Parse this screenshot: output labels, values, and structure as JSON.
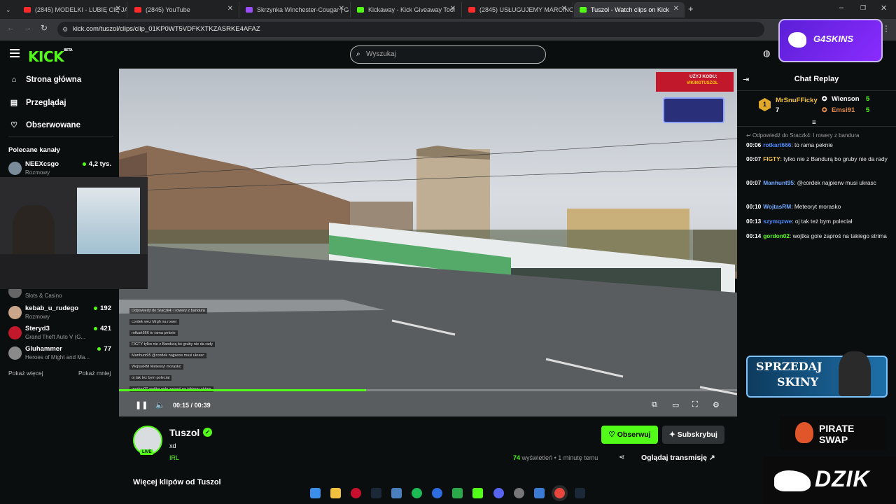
{
  "browser": {
    "tabs": [
      {
        "label": "(2845) MODELKI - LUBIĘ CIĘ JAK",
        "fav": "#ff2a2a"
      },
      {
        "label": "(2845) YouTube",
        "fav": "#ff2a2a"
      },
      {
        "label": "Skrzynka Winchester-Cougar | G",
        "fav": "#9b4dff"
      },
      {
        "label": "Kickaway - Kick Giveaway Tool",
        "fav": "#53fc18"
      },
      {
        "label": "(2845) USŁUGUJEMY MARCINO",
        "fav": "#ff2a2a"
      },
      {
        "label": "Tuszol - Watch clips on Kick",
        "fav": "#53fc18"
      }
    ],
    "url": "kick.com/tuszol/clips/clip_01KP0WT5VDFKXTKZASRKE4AFAZ"
  },
  "header": {
    "logo": "KICK",
    "logo_beta": "BETA",
    "search_placeholder": "Wyszukaj"
  },
  "sidebar": {
    "nav": [
      {
        "label": "Strona główna",
        "icon": "home-icon"
      },
      {
        "label": "Przeglądaj",
        "icon": "browse-icon"
      },
      {
        "label": "Obserwowane",
        "icon": "heart-icon"
      }
    ],
    "section_title": "Polecane kanały",
    "channels": [
      {
        "name": "NEEXcsgo",
        "category": "Rozmowy",
        "viewers": "4,2 tys.",
        "color": "#7a8b99"
      },
      {
        "name": "kebab_u_rudego",
        "category": "Rozmowy",
        "viewers": "192",
        "color": "#c9a58a"
      },
      {
        "name": "Steryd3",
        "category": "Grand Theft Auto V (G...",
        "viewers": "421",
        "color": "#c2182b"
      },
      {
        "name": "Gluhammer",
        "category": "Heroes of Might and Ma...",
        "viewers": "77",
        "color": "#8a8a8a"
      }
    ],
    "partial_channel": {
      "category": "Slots & Casino"
    },
    "show_more": "Pokaż więcej",
    "show_less": "Pokaż mniej"
  },
  "video": {
    "time_current": "00:15",
    "time_separator": "/",
    "time_total": "00:39",
    "progress": 0.4,
    "promo_code_label": "UŻYJ KODU:",
    "promo_code": "VIKINGTUSZOL",
    "overlay_chat": [
      "Odpowiedź do Sraczk4: l rowery z bandura",
      "cordek wez Mrgh na rower",
      "rotkart666 to rama peknie",
      "FIGTY tylko nie z Bandurą bo gruby nie da rady",
      "Manhunt95 @cordek najpierw musi ukrasc",
      "WojtasRM Meteoryt morasko",
      "oj tak też bym poleciał",
      "gordon02 wojtka gole zaproś na takiego strima"
    ]
  },
  "streamer": {
    "name": "Tuszol",
    "title": "xd",
    "category": "IRL",
    "live_badge": "LIVE",
    "follow_label": "Obserwuj",
    "subscribe_label": "Subskrybuj",
    "views_count": "74",
    "views_label": "wyświetleń",
    "time_ago": "• 1 minutę temu",
    "watch_label": "Oglądaj transmisję",
    "more_clips": "Więcej klipów od Tuszol"
  },
  "chat": {
    "title": "Chat Replay",
    "leaderboard": [
      {
        "rank": "1",
        "name": "MrSnuFFicky",
        "count": "7"
      },
      {
        "name": "Wienson",
        "count": "5"
      },
      {
        "name": "Emsi91",
        "count": "5"
      }
    ],
    "reply_to": "Odpowiedź do Sraczk4: l rowery z bandura",
    "messages": [
      {
        "time": "00:06",
        "user": "rotkart666",
        "text": "to rama peknie",
        "color": "#4f8cff"
      },
      {
        "time": "00:07",
        "user": "FIGTY",
        "text": "tylko nie z Bandurą bo gruby nie da rady",
        "color": "#f5c242"
      },
      {
        "time": "00:07",
        "user": "Manhunt95",
        "text": "@cordek najpierw musi ukrasc",
        "color": "#6fa8ff"
      },
      {
        "time": "00:10",
        "user": "WojtasRM",
        "text": "Meteoryt morasko",
        "color": "#6fa8ff"
      },
      {
        "time": "00:13",
        "user": "szymqzwe",
        "text": "oj tak też bym poleciał",
        "color": "#4f8cff"
      },
      {
        "time": "00:14",
        "user": "gordon02",
        "text": "wojtka gole zaproś na takiego strima",
        "color": "#53fc18"
      }
    ]
  },
  "promos": {
    "g4skins": "G4SKINS",
    "sprzedaj_line1": "SPRZEDAJ",
    "sprzedaj_line2": "SKINY",
    "pirate_line1": "PIRATE",
    "pirate_line2": "SWAP",
    "dzik": "DZIK"
  },
  "colors": {
    "accent": "#53fc18",
    "background": "#0b0e0f"
  }
}
